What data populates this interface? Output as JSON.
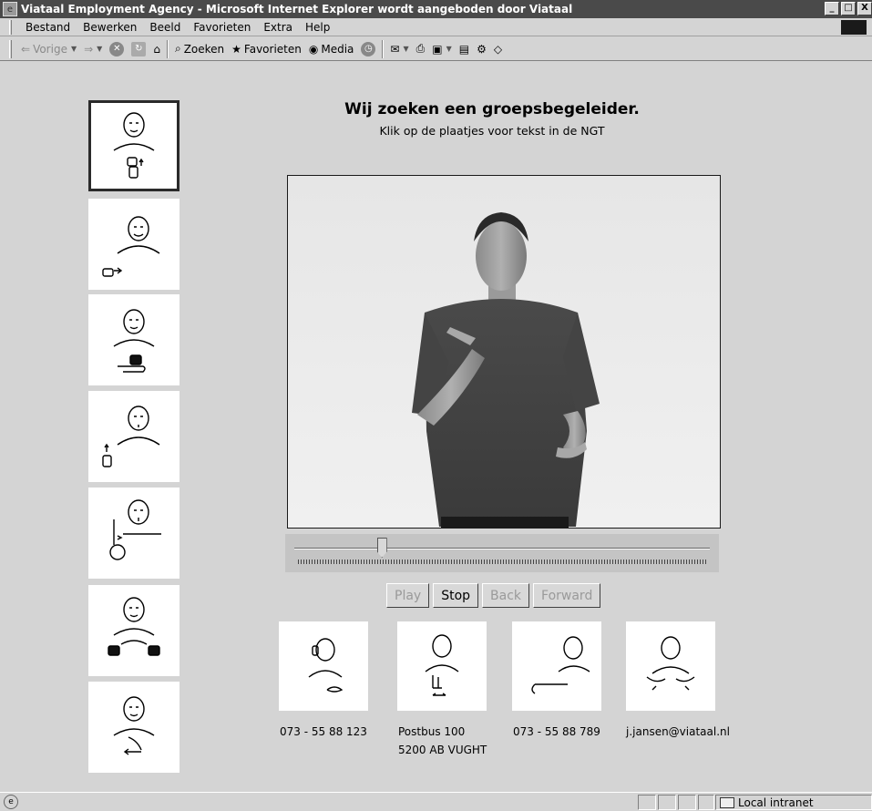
{
  "window": {
    "title": "Viataal Employment Agency - Microsoft Internet Explorer wordt aangeboden door Viataal",
    "minimize": "_",
    "maximize": "□",
    "close": "X"
  },
  "menu": [
    "Bestand",
    "Bewerken",
    "Beeld",
    "Favorieten",
    "Extra",
    "Help"
  ],
  "toolbar": {
    "back": "Vorige",
    "search": "Zoeken",
    "favorites": "Favorieten",
    "media": "Media"
  },
  "page": {
    "heading": "Wij zoeken een groepsbegeleider.",
    "subheading": "Klik op de plaatjes voor tekst in de NGT"
  },
  "sign_tiles": [
    {
      "icon": "sign-glyph-1",
      "selected": true
    },
    {
      "icon": "sign-glyph-2",
      "selected": false
    },
    {
      "icon": "sign-glyph-3",
      "selected": false
    },
    {
      "icon": "sign-glyph-4",
      "selected": false
    },
    {
      "icon": "sign-glyph-5",
      "selected": false
    },
    {
      "icon": "sign-glyph-6",
      "selected": false
    },
    {
      "icon": "sign-glyph-7",
      "selected": false
    }
  ],
  "player": {
    "slider_position": 0.21,
    "buttons": {
      "play": "Play",
      "stop": "Stop",
      "back": "Back",
      "forward": "Forward"
    },
    "enabled": {
      "play": false,
      "stop": true,
      "back": false,
      "forward": false
    }
  },
  "contacts": [
    {
      "icon": "phone-sign-icon",
      "line1": "073 - 55 88 123",
      "line2": ""
    },
    {
      "icon": "address-sign-icon",
      "line1": "Postbus 100",
      "line2": "5200 AB  VUGHT"
    },
    {
      "icon": "fax-sign-icon",
      "line1": "073 - 55 88 789",
      "line2": ""
    },
    {
      "icon": "email-sign-icon",
      "line1": "j.jansen@viataal.nl",
      "line2": ""
    }
  ],
  "status": {
    "zone": "Local intranet"
  }
}
